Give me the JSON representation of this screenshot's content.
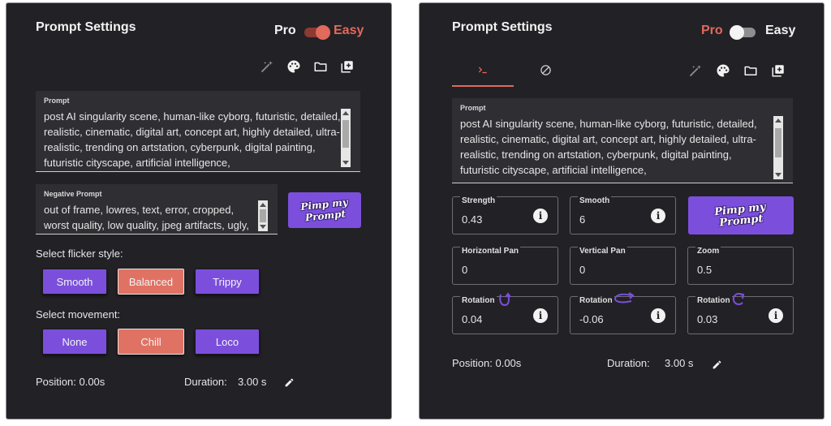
{
  "left": {
    "title": "Prompt Settings",
    "mode": {
      "pro_label": "Pro",
      "easy_label": "Easy"
    },
    "toolbar_icons": [
      "magic-wand-icon",
      "palette-icon",
      "folder-icon",
      "add-box-icon"
    ],
    "prompt": {
      "label": "Prompt",
      "value": "post AI singularity scene, human-like cyborg, futuristic, detailed, realistic, cinematic, digital art, concept art, highly detailed, ultra-realistic, trending on artstation, cyberpunk, digital painting, futuristic cityscape, artificial intelligence,"
    },
    "negative_prompt": {
      "label": "Negative Prompt",
      "value": "out of frame, lowres, text, error, cropped, worst quality, low quality, jpeg artifacts, ugly,"
    },
    "pimp_button": {
      "line1": "Pimp my",
      "line2": "Prompt"
    },
    "flicker": {
      "label": "Select flicker style:",
      "options": [
        "Smooth",
        "Balanced",
        "Trippy"
      ],
      "selected": "Balanced"
    },
    "movement": {
      "label": "Select movement:",
      "options": [
        "None",
        "Chill",
        "Loco"
      ],
      "selected": "Chill"
    },
    "footer": {
      "position": "Position:  0.00s",
      "duration": "Duration:",
      "duration_value": "3.00 s"
    }
  },
  "right": {
    "title": "Prompt Settings",
    "mode": {
      "pro_label": "Pro",
      "easy_label": "Easy"
    },
    "tabs": [
      {
        "icon": "terminal-icon",
        "active": true
      },
      {
        "icon": "block-icon",
        "active": false
      }
    ],
    "toolbar_icons": [
      "magic-wand-icon",
      "palette-icon",
      "folder-icon",
      "add-box-icon"
    ],
    "prompt": {
      "label": "Prompt",
      "value": "post AI singularity scene, human-like cyborg, futuristic, detailed, realistic, cinematic, digital art, concept art, highly detailed, ultra-realistic, trending on artstation, cyberpunk, digital painting, futuristic cityscape, artificial intelligence,"
    },
    "pimp_button": {
      "line1": "Pimp my",
      "line2": "Prompt"
    },
    "fields": {
      "strength": {
        "label": "Strength",
        "value": "0.43"
      },
      "smooth": {
        "label": "Smooth",
        "value": "6"
      },
      "horizontal_pan": {
        "label": "Horizontal Pan",
        "value": "0"
      },
      "vertical_pan": {
        "label": "Vertical Pan",
        "value": "0"
      },
      "zoom": {
        "label": "Zoom",
        "value": "0.5"
      },
      "rotation_x": {
        "label": "Rotation",
        "value": "0.04"
      },
      "rotation_y": {
        "label": "Rotation",
        "value": "-0.06"
      },
      "rotation_z": {
        "label": "Rotation",
        "value": "0.03"
      }
    },
    "footer": {
      "position": "Position:  0.00s",
      "duration": "Duration:",
      "duration_value": "3.00 s"
    }
  },
  "colors": {
    "panel_bg": "#222126",
    "accent_coral": "#e06a5c",
    "accent_purple": "#7b4fdc"
  }
}
